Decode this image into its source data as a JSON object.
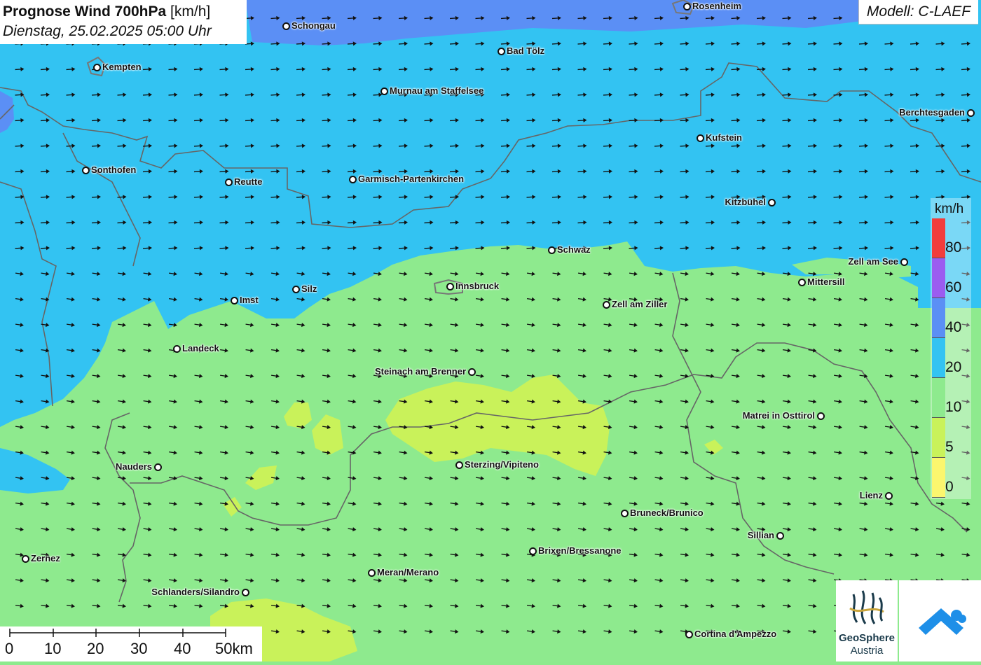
{
  "header": {
    "title": "Prognose Wind 700hPa",
    "unit": "[km/h]",
    "datetime": "Dienstag, 25.02.2025 05:00 Uhr",
    "model": "Modell: C-LAEF"
  },
  "legend": {
    "unit": "km/h",
    "levels": [
      {
        "label": "80",
        "color": "#f23c3c"
      },
      {
        "label": "60",
        "color": "#9b5cf0"
      },
      {
        "label": "40",
        "color": "#5b8ff5"
      },
      {
        "label": "20",
        "color": "#33c3f2"
      },
      {
        "label": "10",
        "color": "#8eea8e"
      },
      {
        "label": "5",
        "color": "#c9f25a"
      },
      {
        "label": "0",
        "color": "#fbf66e"
      }
    ]
  },
  "scalebar": {
    "labels": [
      "0",
      "10",
      "20",
      "30",
      "40",
      "50km"
    ]
  },
  "cities": [
    {
      "name": "Rosenheim",
      "label_side": "right"
    },
    {
      "name": "Schongau",
      "label_side": "right"
    },
    {
      "name": "Bad Tölz",
      "label_side": "right"
    },
    {
      "name": "Kempten",
      "label_side": "right"
    },
    {
      "name": "Murnau am Staffelsee",
      "label_side": "right"
    },
    {
      "name": "Berchtesgaden",
      "label_side": "left"
    },
    {
      "name": "Kufstein",
      "label_side": "right"
    },
    {
      "name": "Sonthofen",
      "label_side": "right"
    },
    {
      "name": "Reutte",
      "label_side": "right"
    },
    {
      "name": "Garmisch-Partenkirchen",
      "label_side": "right"
    },
    {
      "name": "Kitzbühel",
      "label_side": "left"
    },
    {
      "name": "Schwaz",
      "label_side": "right"
    },
    {
      "name": "Zell am See",
      "label_side": "left"
    },
    {
      "name": "Mittersill",
      "label_side": "right"
    },
    {
      "name": "Silz",
      "label_side": "right"
    },
    {
      "name": "Innsbruck",
      "label_side": "right"
    },
    {
      "name": "Imst",
      "label_side": "right"
    },
    {
      "name": "Zell am Ziller",
      "label_side": "right"
    },
    {
      "name": "Landeck",
      "label_side": "right"
    },
    {
      "name": "Steinach am Brenner",
      "label_side": "left"
    },
    {
      "name": "Matrei in Osttirol",
      "label_side": "left"
    },
    {
      "name": "Nauders",
      "label_side": "left"
    },
    {
      "name": "Sterzing/Vipiteno",
      "label_side": "right"
    },
    {
      "name": "Lienz",
      "label_side": "left"
    },
    {
      "name": "Bruneck/Brunico",
      "label_side": "right"
    },
    {
      "name": "Sillian",
      "label_side": "left"
    },
    {
      "name": "Brixen/Bressanone",
      "label_side": "right"
    },
    {
      "name": "Zernez",
      "label_side": "right"
    },
    {
      "name": "Meran/Merano",
      "label_side": "right"
    },
    {
      "name": "Schlanders/Silandro",
      "label_side": "left"
    },
    {
      "name": "Cortina d'Ampezzo",
      "label_side": "right"
    }
  ],
  "logos": {
    "geosphere_name": "GeoSphere",
    "geosphere_sub": "Austria"
  },
  "colors": {
    "zone_0_5": "#fbf66e",
    "zone_5_10": "#c9f25a",
    "zone_10_20": "#8eea8e",
    "zone_20_40": "#33c3f2",
    "zone_40_60": "#5b8ff5",
    "border": "#666666",
    "arrow": "#111111"
  }
}
